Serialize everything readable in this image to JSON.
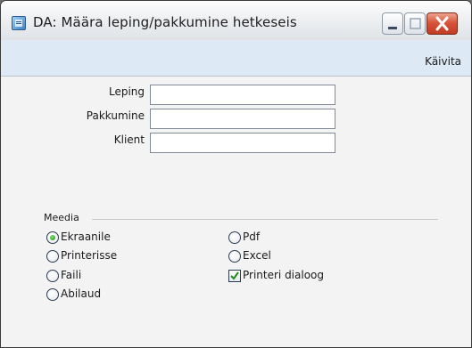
{
  "window": {
    "title": "DA: Määra leping/pakkumine hetkeseis"
  },
  "icons": {
    "app": "app-icon",
    "minimize": "minimize-icon",
    "maximize": "maximize-icon",
    "close": "close-icon",
    "checkmark": "checkmark-icon"
  },
  "toolbar": {
    "run_label": "Käivita"
  },
  "form": {
    "fields": [
      {
        "label": "Leping",
        "value": ""
      },
      {
        "label": "Pakkumine",
        "value": ""
      },
      {
        "label": "Klient",
        "value": ""
      }
    ]
  },
  "media": {
    "group_label": "Meedia",
    "options": [
      {
        "label": "Ekraanile",
        "selected": true
      },
      {
        "label": "Printerisse",
        "selected": false
      },
      {
        "label": "Faili",
        "selected": false
      },
      {
        "label": "Abilaud",
        "selected": false
      },
      {
        "label": "Pdf",
        "selected": false
      },
      {
        "label": "Excel",
        "selected": false
      }
    ],
    "printer_dialog": {
      "label": "Printeri dialoog",
      "checked": true
    }
  },
  "colors": {
    "toolbar_bg": "#dde9f4",
    "close_button": "#d9543a",
    "radio_selected": "#1d8c17"
  }
}
